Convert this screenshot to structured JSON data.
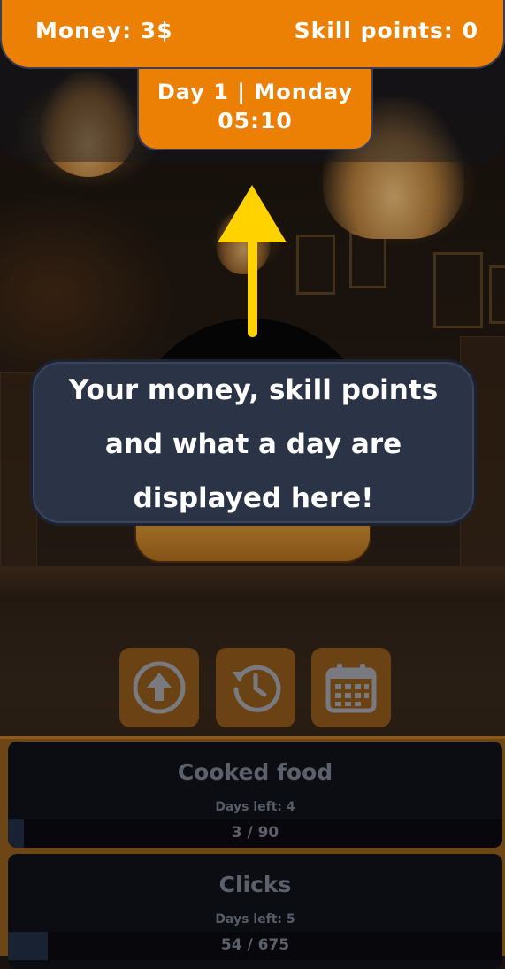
{
  "hud": {
    "money": "Money: 3$",
    "skill_points": "Skill points: 0",
    "day": "Day 1 | Monday",
    "time": "05:10"
  },
  "tutorial": {
    "lines": [
      "Your money, skill points",
      "and what a day are",
      "displayed here!"
    ]
  },
  "actions": [
    {
      "name": "upgrade",
      "icon": "arrow-up-circle-icon"
    },
    {
      "name": "history",
      "icon": "clock-history-icon"
    },
    {
      "name": "calendar",
      "icon": "calendar-icon"
    }
  ],
  "quests": [
    {
      "title": "Cooked food",
      "days_left": "Days left: 4",
      "progress_text": "3 / 90",
      "progress": 0.033
    },
    {
      "title": "Clicks",
      "days_left": "Days left: 5",
      "progress_text": "54 / 675",
      "progress": 0.08
    }
  ],
  "colors": {
    "accent_orange": "#ec8004",
    "bubble_bg": "#2b3346",
    "arrow_yellow": "#ffd200",
    "button_bg": "#6e4514"
  }
}
